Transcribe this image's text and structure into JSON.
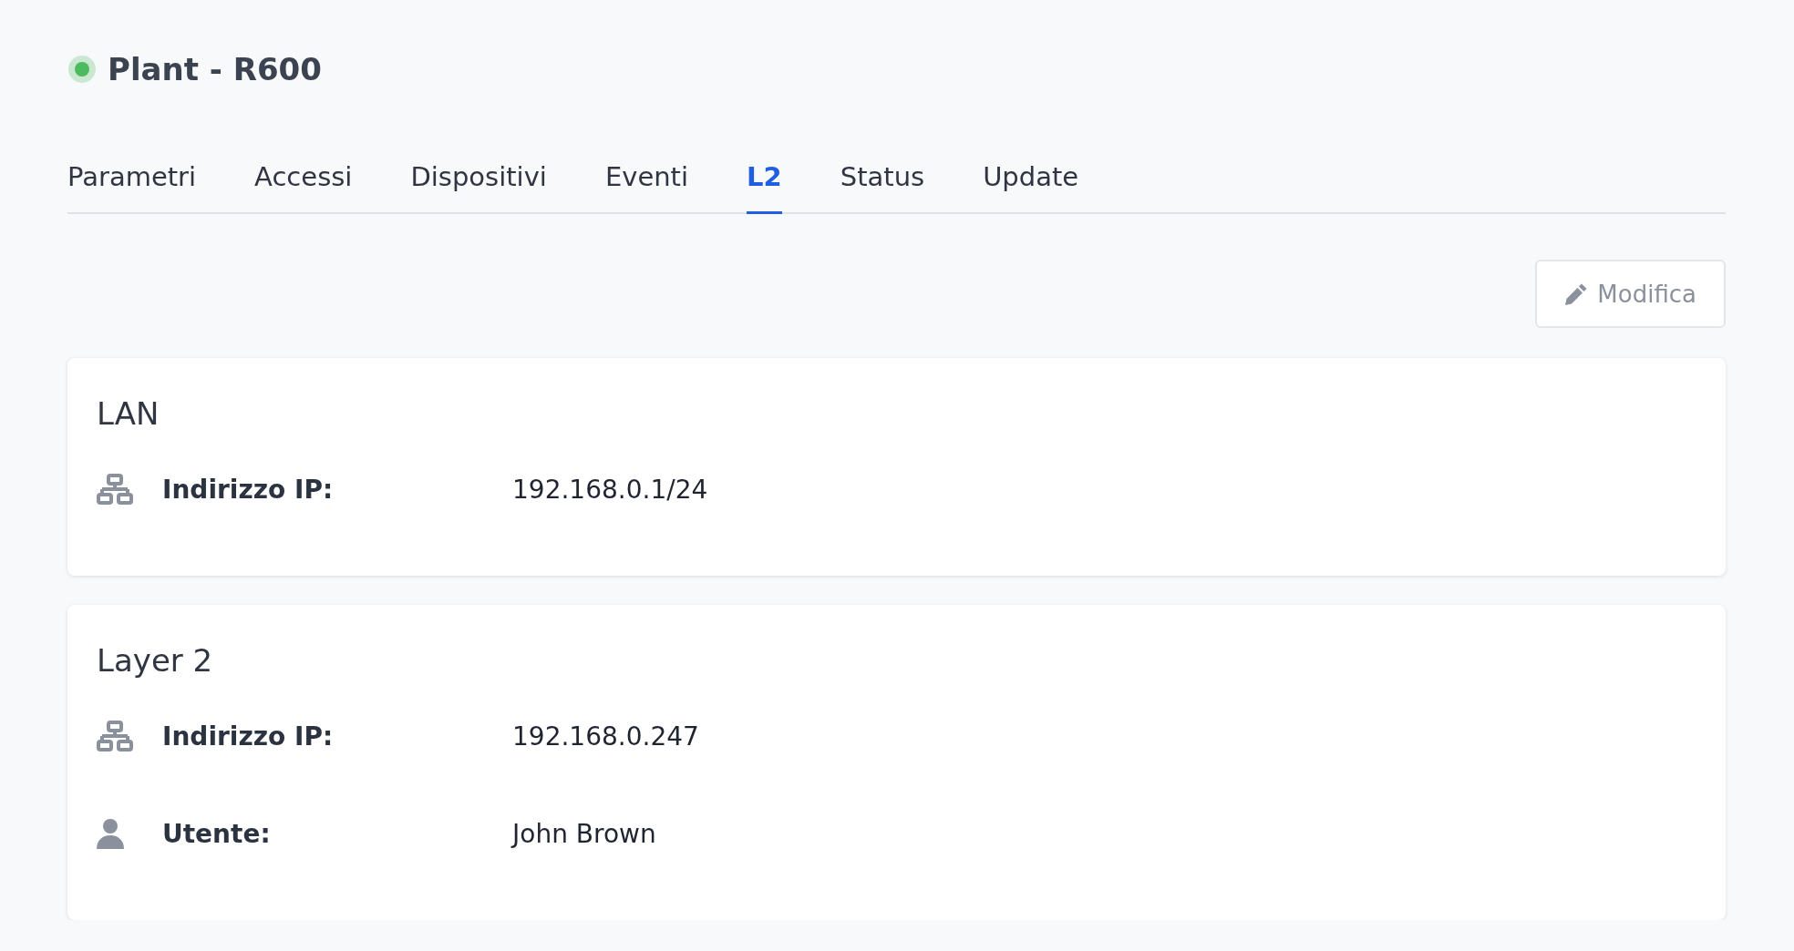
{
  "header": {
    "title": "Plant - R600",
    "online": true
  },
  "tabs": [
    {
      "label": "Parametri",
      "selected": false
    },
    {
      "label": "Accessi",
      "selected": false
    },
    {
      "label": "Dispositivi",
      "selected": false
    },
    {
      "label": "Eventi",
      "selected": false
    },
    {
      "label": "L2",
      "selected": true
    },
    {
      "label": "Status",
      "selected": false
    },
    {
      "label": "Update",
      "selected": false
    }
  ],
  "edit_button": {
    "label": "Modifica",
    "disabled": true
  },
  "cards": [
    {
      "title": "LAN",
      "rows": [
        {
          "kind": "network",
          "label": "Indirizzo IP:",
          "value": "192.168.0.1/24"
        }
      ]
    },
    {
      "title": "Layer 2",
      "rows": [
        {
          "kind": "network",
          "label": "Indirizzo IP:",
          "value": "192.168.0.247"
        },
        {
          "kind": "user",
          "label": "Utente:",
          "value": "John Brown"
        }
      ]
    }
  ]
}
